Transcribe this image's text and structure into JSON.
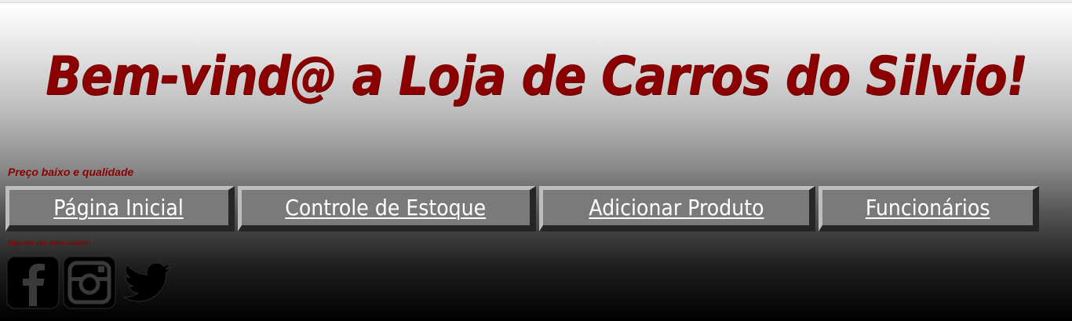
{
  "header": {
    "title": "Bem-vind@ a Loja de Carros do Silvio!",
    "tagline": "Preço baixo e qualidade"
  },
  "nav": {
    "items": [
      {
        "label": "Página Inicial"
      },
      {
        "label": "Controle de Estoque"
      },
      {
        "label": "Adicionar Produto"
      },
      {
        "label": "Funcionários"
      }
    ]
  },
  "social": {
    "caption": "Siga-nos nas redes sociais!",
    "icons": [
      "facebook-icon",
      "instagram-icon",
      "twitter-icon"
    ]
  },
  "colors": {
    "title": "#8b0000",
    "button_face": "#7a7a7a",
    "button_text": "#ffffff"
  }
}
